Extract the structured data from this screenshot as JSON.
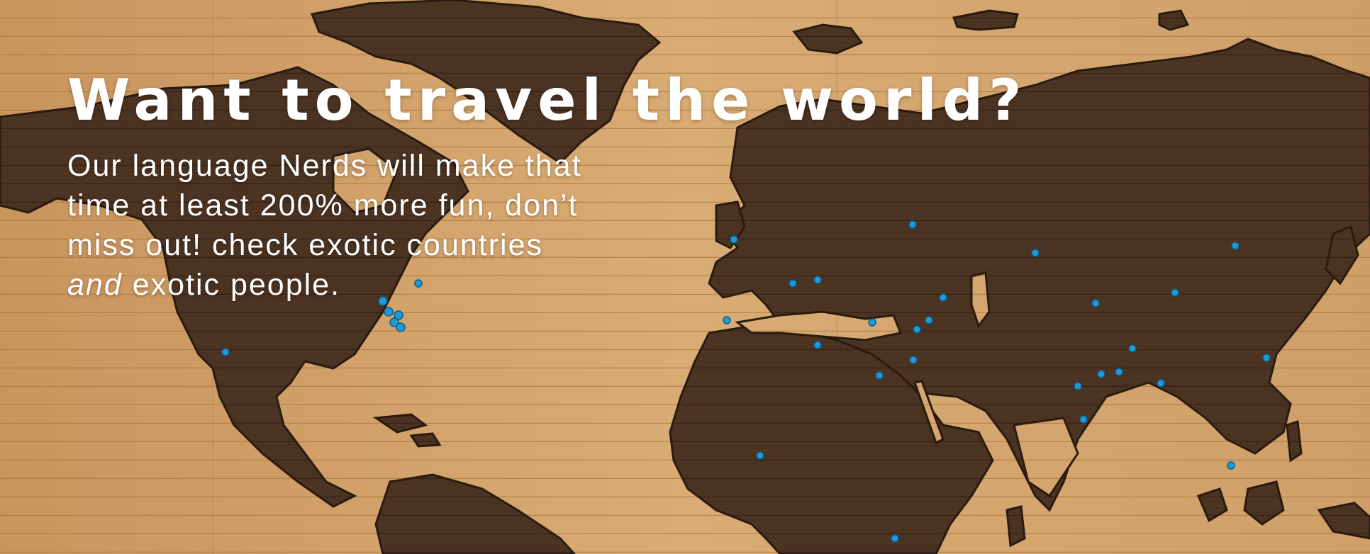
{
  "hero": {
    "headline": "Want to travel the world?",
    "subtext_lines": [
      "Our language Nerds will make that",
      "time at least 200% more fun, don’t",
      "miss out! check exotic countries"
    ],
    "subtext_last_emphasis": "and",
    "subtext_last_rest": " exotic people."
  },
  "colors": {
    "wood_light": "#d7a86f",
    "wood_dark_continent": "#4a3220",
    "pin_blue": "#1e9bd7",
    "text": "#ffffff"
  }
}
